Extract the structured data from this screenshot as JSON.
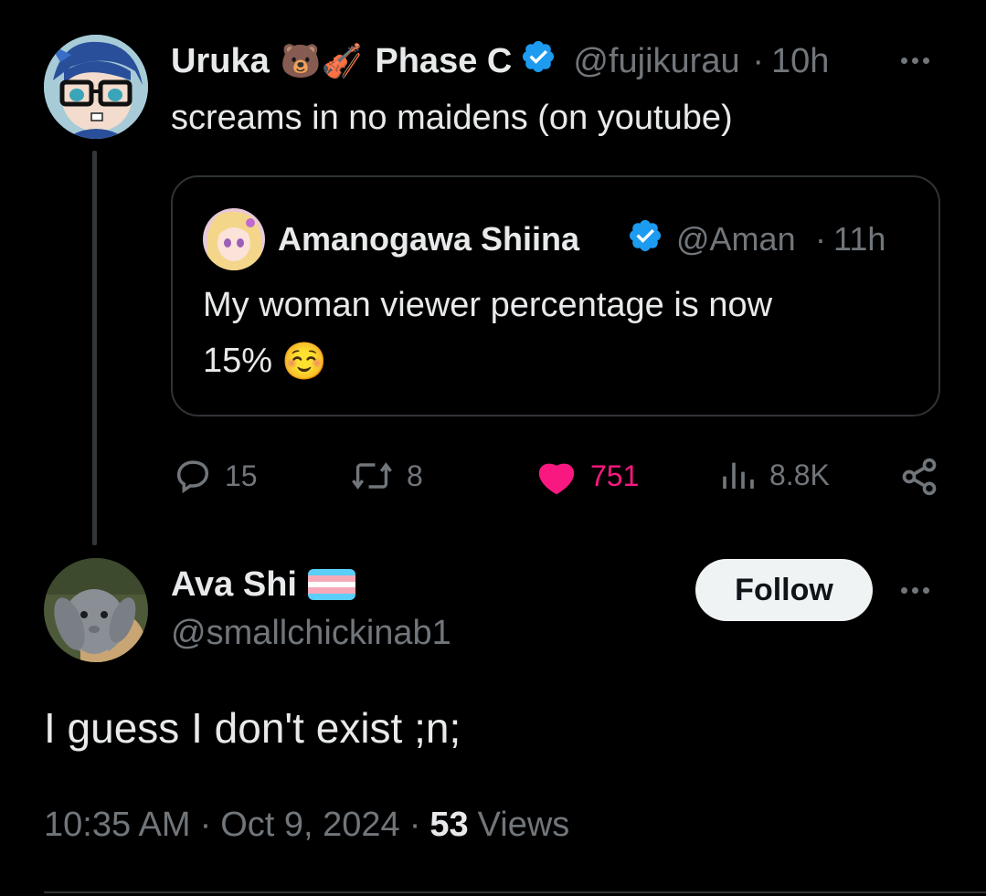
{
  "parent_tweet": {
    "display_name": "Uruka",
    "name_emojis": "🐻🎻",
    "name_suffix": "Phase C",
    "handle": "@fujikurau",
    "time": "10h",
    "text": "screams in no maidens (on youtube)",
    "quoted": {
      "display_name": "Amanogawa Shiina",
      "handle": "@Aman",
      "time": "11h",
      "text_line1": "My woman viewer percentage is now",
      "text_line2": "15%",
      "emoji": "☺️"
    },
    "metrics": {
      "replies": "15",
      "reposts": "8",
      "likes": "751",
      "views": "8.8K"
    }
  },
  "main_tweet": {
    "display_name": "Ava Shi",
    "handle": "@smallchickinab1",
    "follow_label": "Follow",
    "text": "I guess I don't exist ;n;",
    "time": "10:35 AM",
    "date": "Oct 9, 2024",
    "views_count": "53",
    "views_label": "Views"
  },
  "colors": {
    "background": "#000000",
    "text": "#e7e9ea",
    "muted": "#71767b",
    "like": "#f91880",
    "verified": "#1d9bf0",
    "border": "#2f3336"
  },
  "icons": [
    "reply-icon",
    "repost-icon",
    "like-icon",
    "views-icon",
    "share-icon",
    "more-icon",
    "verified-badge-icon",
    "trans-flag-icon"
  ]
}
